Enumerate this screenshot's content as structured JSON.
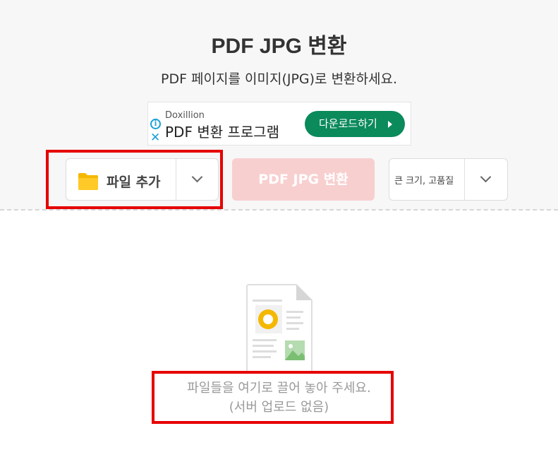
{
  "header": {
    "title": "PDF JPG 변환",
    "subtitle": "PDF 페이지를 이미지(JPG)로 변환하세요."
  },
  "ad": {
    "brand": "Doxillion",
    "title": "PDF 변환 프로그램",
    "button_label": "다운로드하기",
    "info_icon": "info-icon",
    "close_icon": "close-icon"
  },
  "toolbar": {
    "add_file_label": "파일 추가",
    "add_file_icon": "folder-icon",
    "convert_label": "PDF JPG 변환",
    "quality_label": "큰 크기, 고품질"
  },
  "drop_area": {
    "line1": "파일들을 여기로 끌어 놓아 주세요.",
    "line2": "(서버 업로드 없음)"
  },
  "colors": {
    "accent": "#0b8a5c",
    "convert_disabled": "#f8cfcf",
    "highlight": "#e60000",
    "folder": "#f5b800"
  }
}
